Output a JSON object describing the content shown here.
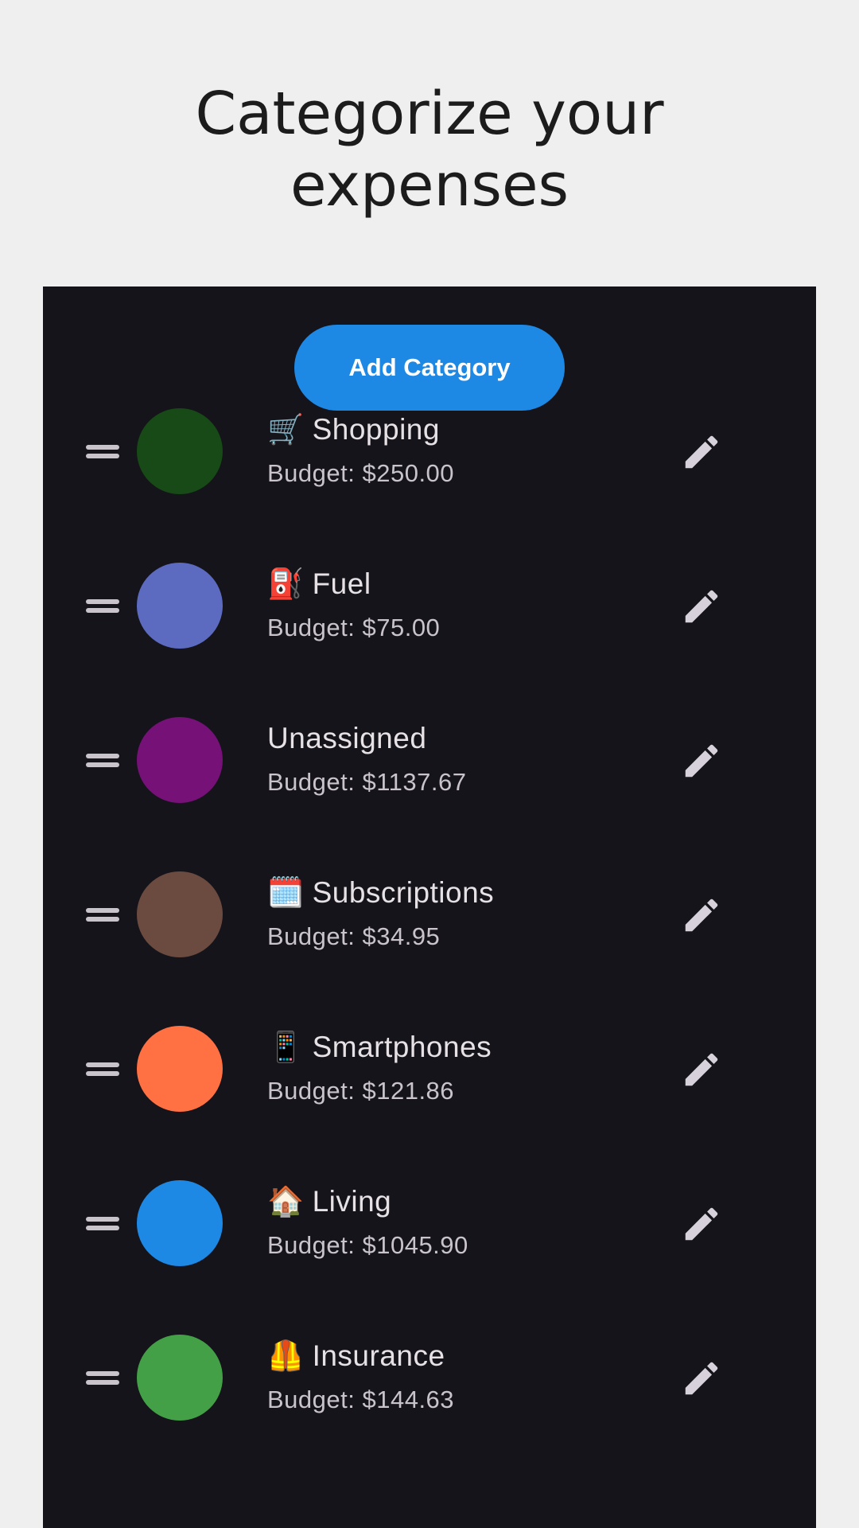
{
  "header": {
    "title_line1": "Categorize your",
    "title_line2": "expenses"
  },
  "toolbar": {
    "add_category_label": "Add Category"
  },
  "colors": {
    "accent": "#1e88e5",
    "surface": "#15141a",
    "background": "#efefef"
  },
  "categories": [
    {
      "emoji": "🛒",
      "name": "Shopping",
      "budget": "Budget: $250.00",
      "color": "#174a16"
    },
    {
      "emoji": "⛽",
      "name": "Fuel",
      "budget": "Budget: $75.00",
      "color": "#5c6bc0"
    },
    {
      "emoji": "",
      "name": "Unassigned",
      "budget": "Budget: $1137.67",
      "color": "#751177"
    },
    {
      "emoji": "🗓️",
      "name": "Subscriptions",
      "budget": "Budget: $34.95",
      "color": "#6b4a40"
    },
    {
      "emoji": "📱",
      "name": "Smartphones",
      "budget": "Budget: $121.86",
      "color": "#ff7043"
    },
    {
      "emoji": "🏠",
      "name": "Living",
      "budget": "Budget: $1045.90",
      "color": "#1e88e5"
    },
    {
      "emoji": "🦺",
      "name": "Insurance",
      "budget": "Budget: $144.63",
      "color": "#43a047"
    }
  ],
  "icons": {
    "drag": "drag-handle-icon",
    "edit": "pencil-edit-icon"
  }
}
